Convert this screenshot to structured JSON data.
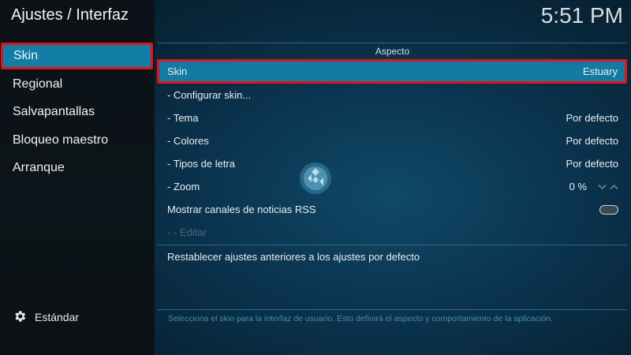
{
  "header": {
    "title": "Ajustes / Interfaz",
    "clock": "5:51 PM"
  },
  "sidebar": {
    "items": [
      {
        "label": "Skin",
        "active": true
      },
      {
        "label": "Regional",
        "active": false
      },
      {
        "label": "Salvapantallas",
        "active": false
      },
      {
        "label": "Bloqueo maestro",
        "active": false
      },
      {
        "label": "Arranque",
        "active": false
      }
    ],
    "settings_level": {
      "icon": "gear-icon",
      "label": "Estándar"
    }
  },
  "main": {
    "section_title": "Aspecto",
    "rows": [
      {
        "label": "Skin",
        "value": "Estuary"
      },
      {
        "label": "- Configurar skin...",
        "value": ""
      },
      {
        "label": "- Tema",
        "value": "Por defecto"
      },
      {
        "label": "- Colores",
        "value": "Por defecto"
      },
      {
        "label": "- Tipos de letra",
        "value": "Por defecto"
      },
      {
        "label": "- Zoom",
        "value": "0 %"
      },
      {
        "label": "Mostrar canales de noticias RSS",
        "toggle": false
      },
      {
        "label": "- - Editar",
        "disabled": true
      },
      {
        "label": "Restablecer ajustes anteriores a los ajustes por defecto"
      }
    ],
    "description": "Selecciona el skin para la interfaz de usuario. Esto definirá el aspecto y comportamiento de la aplicación."
  },
  "colors": {
    "accent": "#127ea6",
    "focus_border": "#e3121b"
  }
}
